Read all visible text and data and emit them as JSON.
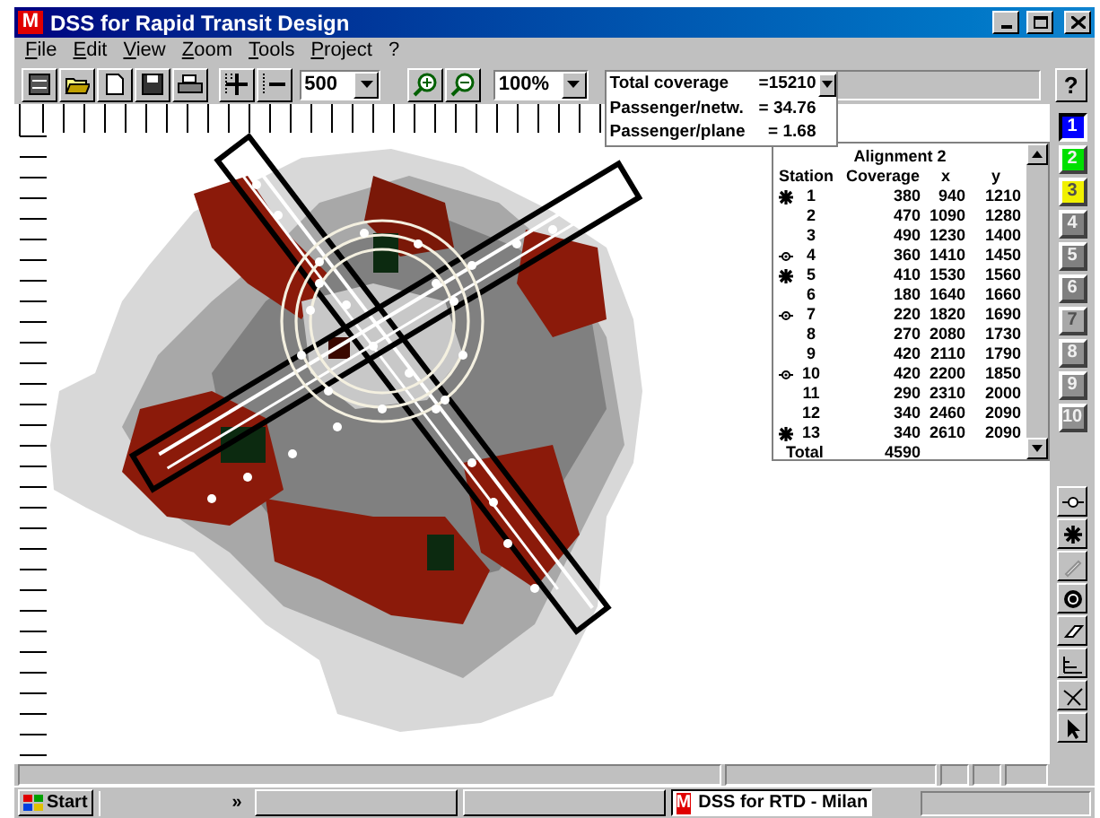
{
  "window": {
    "logo": "M",
    "title": "DSS for Rapid Transit Design"
  },
  "menu": [
    "File",
    "Edit",
    "View",
    "Zoom",
    "Tools",
    "Project",
    "?"
  ],
  "toolbar": {
    "scale": "500",
    "zoom": "100%",
    "help": "?"
  },
  "coverage": [
    {
      "label": "Total coverage",
      "value": "=15210"
    },
    {
      "label": "Passenger/netw.",
      "value": "= 34.76"
    },
    {
      "label": "Passenger/plane",
      "value": "= 1.68"
    }
  ],
  "table": {
    "title": "Alignment 2",
    "columns": [
      "Station",
      "Coverage",
      "x",
      "y"
    ],
    "rows": [
      {
        "kind": "star",
        "cells": [
          "1",
          "380",
          "940",
          "1210"
        ]
      },
      {
        "kind": "plain",
        "cells": [
          "2",
          "470",
          "1090",
          "1280"
        ]
      },
      {
        "kind": "plain",
        "cells": [
          "3",
          "490",
          "1230",
          "1400"
        ]
      },
      {
        "kind": "eye",
        "cells": [
          "4",
          "360",
          "1410",
          "1450"
        ]
      },
      {
        "kind": "star",
        "cells": [
          "5",
          "410",
          "1530",
          "1560"
        ]
      },
      {
        "kind": "plain",
        "cells": [
          "6",
          "180",
          "1640",
          "1660"
        ]
      },
      {
        "kind": "eye",
        "cells": [
          "7",
          "220",
          "1820",
          "1690"
        ]
      },
      {
        "kind": "plain",
        "cells": [
          "8",
          "270",
          "2080",
          "1730"
        ]
      },
      {
        "kind": "plain",
        "cells": [
          "9",
          "420",
          "2110",
          "1790"
        ]
      },
      {
        "kind": "eye",
        "cells": [
          "10",
          "420",
          "2200",
          "1850"
        ]
      },
      {
        "kind": "plain",
        "cells": [
          "11",
          "290",
          "2310",
          "2000"
        ]
      },
      {
        "kind": "plain",
        "cells": [
          "12",
          "340",
          "2460",
          "2090"
        ]
      },
      {
        "kind": "star",
        "cells": [
          "13",
          "340",
          "2610",
          "2090"
        ]
      }
    ],
    "total": {
      "label": "Total",
      "value": "4590"
    }
  },
  "alignments": [
    {
      "label": "1",
      "color": "#0000ff",
      "selected": true
    },
    {
      "label": "2",
      "color": "#00e000",
      "selected": false
    },
    {
      "label": "3",
      "color": "#f0f000",
      "selected": false
    },
    {
      "label": "4",
      "color": "#808080",
      "selected": false
    },
    {
      "label": "5",
      "color": "#808080",
      "selected": false
    },
    {
      "label": "6",
      "color": "#808080",
      "selected": false
    },
    {
      "label": "7",
      "color": "#a8a8a8",
      "selected": false
    },
    {
      "label": "8",
      "color": "#909090",
      "selected": false
    },
    {
      "label": "9",
      "color": "#909090",
      "selected": false
    },
    {
      "label": "10",
      "color": "#909090",
      "selected": false
    }
  ],
  "taskbar": {
    "start": "Start",
    "chevron": "»",
    "task": {
      "logo": "M",
      "label": "DSS for RTD - Milan"
    }
  }
}
